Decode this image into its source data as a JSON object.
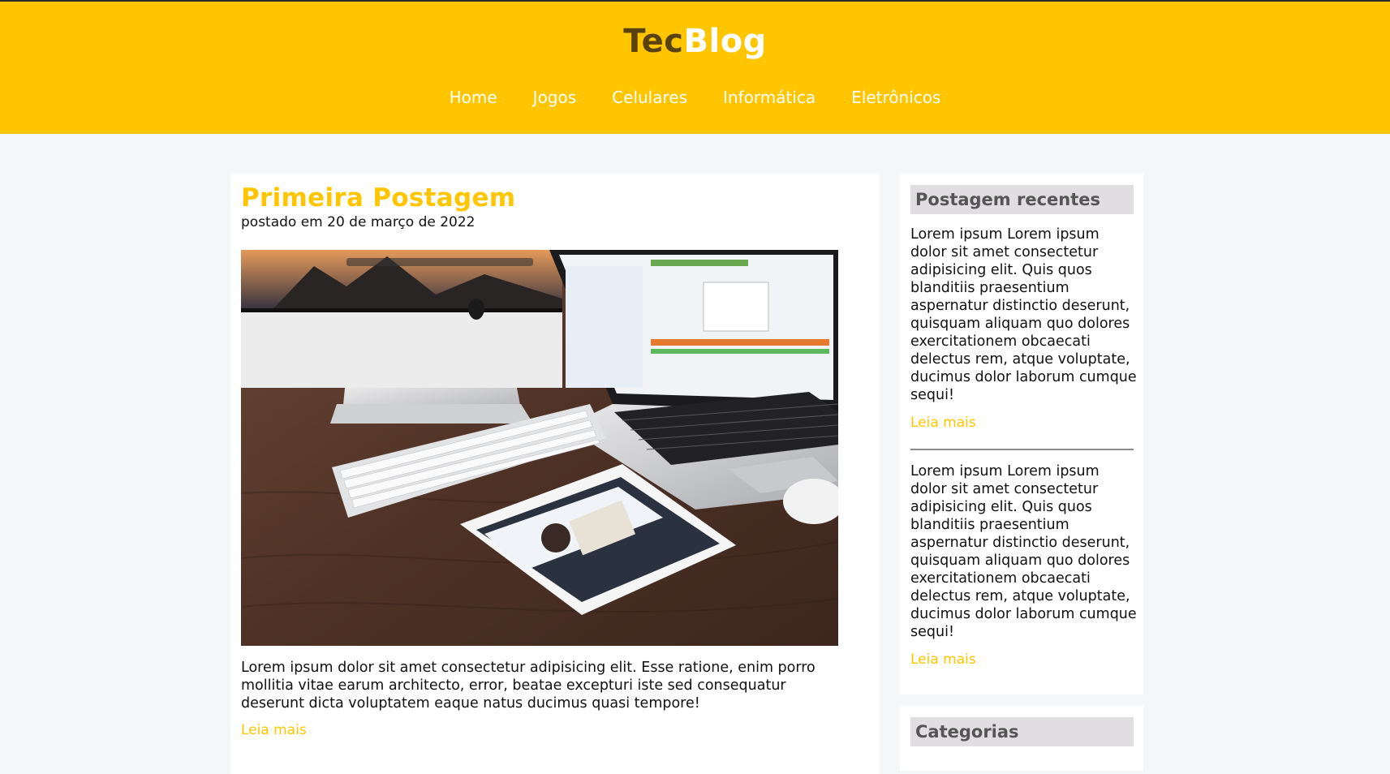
{
  "header": {
    "logo_part1": "Tec",
    "logo_part2": "Blog",
    "nav": [
      "Home",
      "Jogos",
      "Celulares",
      "Informática",
      "Eletrônicos"
    ]
  },
  "post": {
    "title": "Primeira Postagem",
    "meta": "postado em 20 de março de 2022",
    "excerpt": "Lorem ipsum dolor sit amet consectetur adipisicing elit. Esse ratione, enim porro mollitia vitae earum architecto, error, beatae excepturi iste sed consequatur deserunt dicta voluptatem eaque natus ducimus quasi tempore!",
    "read_more": "Leia mais"
  },
  "sidebar": {
    "recent_title": "Postagem recentes",
    "recent_posts": [
      {
        "text": "Lorem ipsum Lorem ipsum dolor sit amet consectetur adipisicing elit. Quis quos blanditiis praesentium aspernatur distinctio deserunt, quisquam aliquam quo dolores exercitationem obcaecati delectus rem, atque voluptate, ducimus dolor laborum cumque sequi!",
        "read_more": "Leia mais"
      },
      {
        "text": "Lorem ipsum Lorem ipsum dolor sit amet consectetur adipisicing elit. Quis quos blanditiis praesentium aspernatur distinctio deserunt, quisquam aliquam quo dolores exercitationem obcaecati delectus rem, atque voluptate, ducimus dolor laborum cumque sequi!",
        "read_more": "Leia mais"
      }
    ],
    "categories_title": "Categorias"
  },
  "colors": {
    "accent": "#ffc600",
    "logo_dark": "#5a4210",
    "page_bg": "#f5f6f8",
    "side_head_bg": "#e0dee0"
  }
}
